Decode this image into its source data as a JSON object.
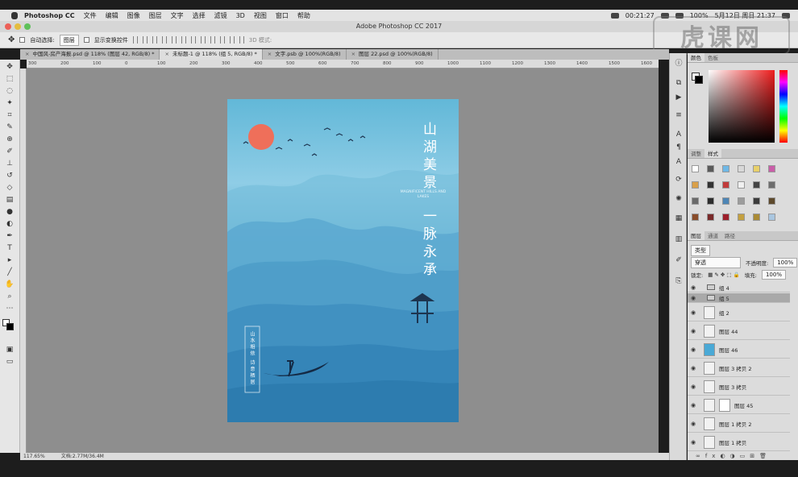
{
  "menubar": {
    "app_name": "Photoshop CC",
    "items": [
      "文件",
      "编辑",
      "图像",
      "图层",
      "文字",
      "选择",
      "滤镜",
      "3D",
      "视图",
      "窗口",
      "帮助"
    ],
    "time": "00:21:27",
    "battery": "100%",
    "date": "5月12日 周日  21:37"
  },
  "window": {
    "title": "Adobe Photoshop CC 2017"
  },
  "options": {
    "auto_select_label": "自动选择:",
    "auto_select_value": "图层",
    "show_transform_label": "显示变换控件",
    "mode_3d_label": "3D 模式:"
  },
  "tabs": [
    {
      "label": "中国风-房产海报.psd @ 118% (图层 42, RGB/8) *"
    },
    {
      "label": "未标题-1 @ 118% (组 5, RGB/8) *"
    },
    {
      "label": "文字.psb @ 100%(RGB/8)"
    },
    {
      "label": "图层 22.psd @ 100%(RGB/8)"
    }
  ],
  "active_tab_index": 1,
  "ruler": {
    "h_labels": [
      "300",
      "200",
      "100",
      "0",
      "100",
      "200",
      "300",
      "400",
      "500",
      "600",
      "700",
      "800",
      "900",
      "1000",
      "1100",
      "1200",
      "1300",
      "1400",
      "1500",
      "1600"
    ],
    "sign_negative_count": 3
  },
  "poster": {
    "title_line1": "山湖美景",
    "title_line2": "一脉永承",
    "subtitle": "MAGNIFICENT HILLS AND LAKES",
    "small_text": "山水相依  诗意栖居"
  },
  "status": {
    "zoom": "117.65%",
    "doc": "文档:2.77M/36.4M"
  },
  "panels": {
    "color_tabs": [
      "颜色",
      "色板"
    ],
    "styles_tabs": [
      "调整",
      "样式"
    ],
    "layers_tabs": [
      "图层",
      "通道",
      "路径"
    ],
    "layer_filter_label": "类型",
    "blend_mode": "穿透",
    "opacity_label": "不透明度:",
    "opacity_value": "100%",
    "lock_label": "锁定:",
    "fill_label": "填充:",
    "fill_value": "100%"
  },
  "layers": [
    {
      "name": "组 4",
      "kind": "folder",
      "selected": false
    },
    {
      "name": "组 5",
      "kind": "folder",
      "selected": true
    },
    {
      "name": "组 2",
      "kind": "smart",
      "selected": false
    },
    {
      "name": "图层 44",
      "kind": "smart",
      "selected": false
    },
    {
      "name": "图层 46",
      "kind": "blue",
      "selected": false
    },
    {
      "name": "图层 3 拷贝 2",
      "kind": "smart",
      "selected": false
    },
    {
      "name": "图层 3 拷贝",
      "kind": "smart",
      "selected": false
    },
    {
      "name": "图层 45",
      "kind": "mask",
      "selected": false
    },
    {
      "name": "图层 1 拷贝 2",
      "kind": "smart",
      "selected": false
    },
    {
      "name": "图层 1 拷贝",
      "kind": "smart",
      "selected": false
    }
  ],
  "colors": {
    "sun": "#ef6f5a",
    "poster_top": "#62b8d8",
    "poster_bottom": "#2c7eb0",
    "canvas_bg": "#8e8e8e"
  }
}
